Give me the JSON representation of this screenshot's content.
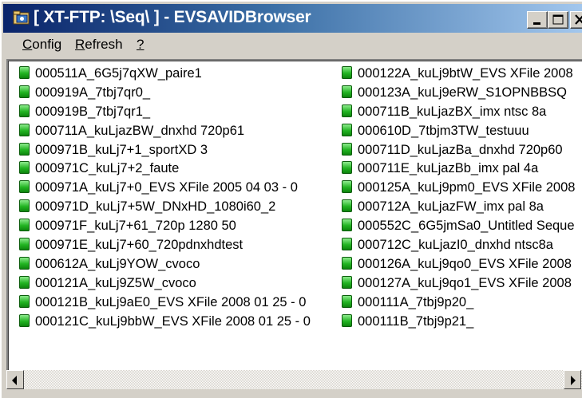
{
  "window": {
    "title": "[ XT-FTP: \\Seq\\ ] - EVSAVIDBrowser",
    "app_icon": "folder-app-icon",
    "controls": [
      "minimize-icon",
      "maximize-icon",
      "close-icon"
    ]
  },
  "menu": {
    "config": {
      "pre": "",
      "u": "C",
      "post": "onfig"
    },
    "refresh": {
      "pre": "",
      "u": "R",
      "post": "efresh"
    },
    "help": {
      "pre": "",
      "u": "?",
      "post": ""
    }
  },
  "list": {
    "item_icon": "green-clip-icon",
    "items": [
      "000511A_6G5j7qXW_paire1",
      "000919A_7tbj7qr0_",
      "000919B_7tbj7qr1_",
      "000711A_kuLjazBW_dnxhd 720p61",
      "000971B_kuLj7+1_sportXD 3",
      "000971C_kuLj7+2_faute",
      "000971A_kuLj7+0_EVS XFile 2005 04 03 - 0",
      "000971D_kuLj7+5W_DNxHD_1080i60_2",
      "000971F_kuLj7+61_720p 1280 50",
      "000971E_kuLj7+60_720pdnxhdtest",
      "000612A_kuLj9YOW_cvoco",
      "000121A_kuLj9Z5W_cvoco",
      "000121B_kuLj9aE0_EVS XFile 2008 01 25 - 0",
      "000121C_kuLj9bbW_EVS XFile 2008 01 25 - 0",
      "000122A_kuLj9btW_EVS XFile 2008",
      "000123A_kuLj9eRW_S1OPNBBSQ",
      "000711B_kuLjazBX_imx ntsc 8a",
      "000610D_7tbjm3TW_testuuu",
      "000711D_kuLjazBa_dnxhd 720p60",
      "000711E_kuLjazBb_imx pal 4a",
      "000125A_kuLj9pm0_EVS XFile 2008",
      "000712A_kuLjazFW_imx pal 8a",
      "000552C_6G5jmSa0_Untitled Seque",
      "000712C_kuLjazI0_dnxhd ntsc8a",
      "000126A_kuLj9qo0_EVS XFile 2008",
      "000127A_kuLj9qo1_EVS XFile 2008",
      "000111A_7tbj9p20_",
      "000111B_7tbj9p21_"
    ]
  },
  "scrollbar": {
    "left_icon": "scroll-left-arrow-icon",
    "right_icon": "scroll-right-arrow-icon"
  }
}
